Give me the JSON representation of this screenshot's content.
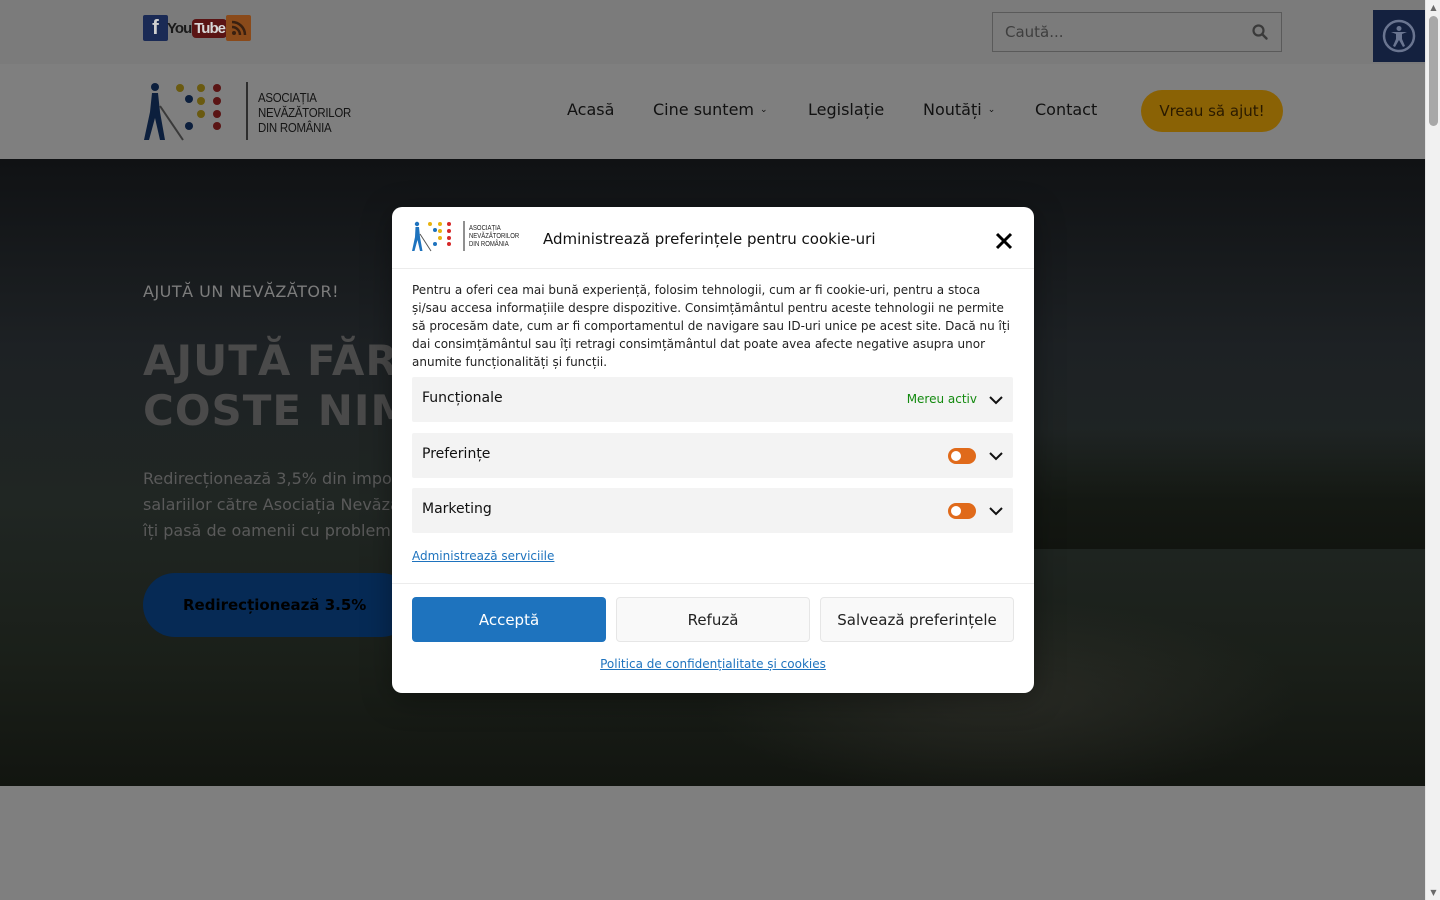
{
  "topbar": {
    "social": {
      "facebook": "f",
      "youtube_a": "You",
      "youtube_b": "Tube",
      "rss": "rss-icon"
    },
    "search": {
      "placeholder": "Caută..."
    },
    "accessibility_icon": "accessibility-icon"
  },
  "header": {
    "logo_text": [
      "ASOCIAȚIA",
      "NEVĂZĂTORILOR",
      "DIN ROMÂNIA"
    ],
    "nav": [
      {
        "label": "Acasă"
      },
      {
        "label": "Cine suntem"
      },
      {
        "label": "Legislație"
      },
      {
        "label": "Noutăți"
      },
      {
        "label": "Contact"
      }
    ],
    "cta": "Vreau să ajut!"
  },
  "hero": {
    "kicker": "AJUTĂ UN NEVĂZĂTOR!",
    "title_line1": "AJUTĂ FĂR",
    "title_line2": "COSTE NIM",
    "text_line1": "Redirecționează 3,5% din impoz",
    "text_line2": "salariilor către Asociația Nevăză",
    "text_line3": "îți pasă de oamenii cu problem",
    "button": "Redirecționează 3.5%"
  },
  "modal": {
    "logo_text": [
      "ASOCIAȚIA",
      "NEVĂZĂTORILOR",
      "DIN ROMÂNIA"
    ],
    "title": "Administrează preferințele pentru cookie-uri",
    "body": "Pentru a oferi cea mai bună experiență, folosim tehnologii, cum ar fi cookie-uri, pentru a stoca și/sau accesa informațiile despre dispozitive. Consimțământul pentru aceste tehnologii ne permite să procesăm date, cum ar fi comportamentul de navigare sau ID-uri unice pe acest site. Dacă nu îți dai consimțământul sau îți retragi consimțământul dat poate avea afecte negative asupra unor anumite funcționalități și funcții.",
    "categories": [
      {
        "label": "Funcționale",
        "status": "Mereu activ"
      },
      {
        "label": "Preferințe"
      },
      {
        "label": "Marketing"
      }
    ],
    "manage_services": "Administrează serviciile",
    "buttons": {
      "accept": "Acceptă",
      "deny": "Refuză",
      "save": "Salvează preferințele"
    },
    "policy_link": "Politica de confidențialitate și cookies"
  },
  "colors": {
    "accent_blue": "#1e73be",
    "toggle_orange": "#e06a1a",
    "status_green": "#138a0f",
    "cta_gold": "#8a6205"
  }
}
